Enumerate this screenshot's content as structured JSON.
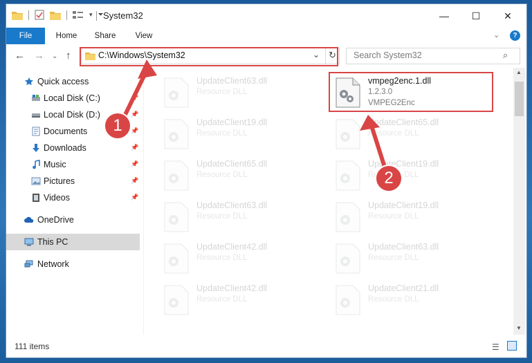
{
  "window": {
    "title": "System32"
  },
  "controls": {
    "minimize": "—",
    "maximize": "☐",
    "close": "✕"
  },
  "ribbon": {
    "tabs": [
      "File",
      "Home",
      "Share",
      "View"
    ]
  },
  "address": {
    "path": "C:\\Windows\\System32"
  },
  "search": {
    "placeholder": "Search System32"
  },
  "sidebar": {
    "items": [
      {
        "label": "Quick access",
        "icon": "star-icon"
      },
      {
        "label": "Local Disk (C:)",
        "icon": "drive-icon"
      },
      {
        "label": "Local Disk (D:)",
        "icon": "drive-icon"
      },
      {
        "label": "Documents",
        "icon": "documents-icon"
      },
      {
        "label": "Downloads",
        "icon": "download-icon"
      },
      {
        "label": "Music",
        "icon": "music-icon"
      },
      {
        "label": "Pictures",
        "icon": "pictures-icon"
      },
      {
        "label": "Videos",
        "icon": "videos-icon"
      },
      {
        "label": "OneDrive",
        "icon": "cloud-icon"
      },
      {
        "label": "This PC",
        "icon": "computer-icon"
      },
      {
        "label": "Network",
        "icon": "network-icon"
      }
    ]
  },
  "files": {
    "left": [
      {
        "name": "UpdateClient63.dll",
        "type": "Resource DLL"
      },
      {
        "name": "UpdateClient19.dll",
        "type": "Resource DLL"
      },
      {
        "name": "UpdateClient65.dll",
        "type": "Resource DLL"
      },
      {
        "name": "UpdateClient63.dll",
        "type": "Resource DLL"
      },
      {
        "name": "UpdateClient42.dll",
        "type": "Resource DLL"
      },
      {
        "name": "UpdateClient42.dll",
        "type": "Resource DLL"
      }
    ],
    "right": [
      {
        "name": "vmpeg2enc.1.dll",
        "version": "1.2.3.0",
        "type": "VMPEG2Enc"
      },
      {
        "name": "UpdateClient65.dll",
        "type": "Resource DLL"
      },
      {
        "name": "UpdateClient19.dll",
        "type": "Resource DLL"
      },
      {
        "name": "UpdateClient19.dll",
        "type": "Resource DLL"
      },
      {
        "name": "UpdateClient63.dll",
        "type": "Resource DLL"
      },
      {
        "name": "UpdateClient21.dll",
        "type": "Resource DLL"
      }
    ]
  },
  "status": {
    "items": "111 items"
  },
  "annotations": {
    "step1": "1",
    "step2": "2"
  },
  "colors": {
    "accent": "#1979ca",
    "highlight": "#d94545"
  }
}
